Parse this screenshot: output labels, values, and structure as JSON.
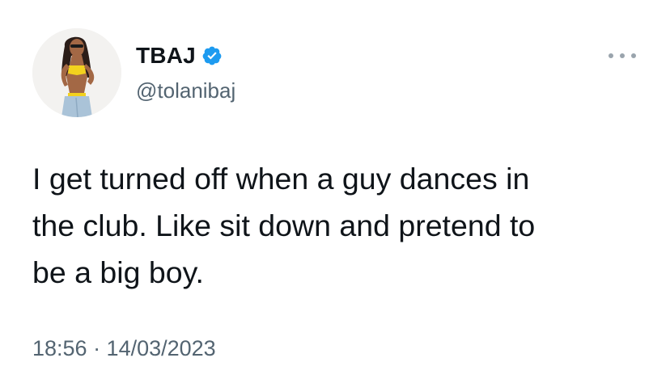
{
  "user": {
    "display_name": "TBAJ",
    "handle": "@tolanibaj",
    "verified": true,
    "verified_color": "#1d9bf0",
    "avatar_icon": "profile-photo"
  },
  "tweet": {
    "text": "I get turned off when a guy dances in\nthe club. Like sit down and pretend to\nbe a big boy.",
    "timestamp": "18:56 · 14/03/2023"
  },
  "icons": {
    "more": "more-options-icon",
    "verified": "verified-badge-icon"
  },
  "colors": {
    "text": "#0f1419",
    "secondary": "#536471",
    "background": "#ffffff"
  }
}
